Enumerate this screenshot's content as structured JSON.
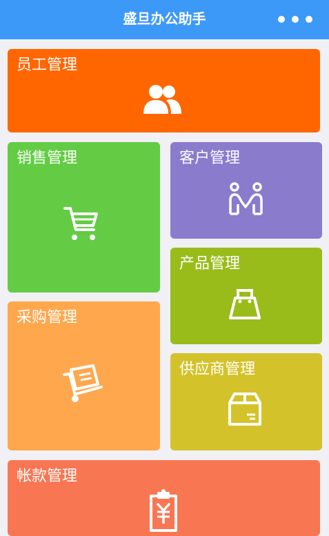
{
  "header": {
    "title": "盛旦办公助手",
    "more_icon": "more-dots-icon",
    "background": "#3d99f8"
  },
  "tiles": [
    {
      "id": "employee",
      "label": "员工管理",
      "icon": "users-icon",
      "color": "#ff6600"
    },
    {
      "id": "sales",
      "label": "销售管理",
      "icon": "shopping-cart-icon",
      "color": "#63cc44"
    },
    {
      "id": "customer",
      "label": "客户管理",
      "icon": "handshake-people-icon",
      "color": "#8a7bcd"
    },
    {
      "id": "product",
      "label": "产品管理",
      "icon": "shopping-bag-icon",
      "color": "#99bc1a"
    },
    {
      "id": "purchase",
      "label": "采购管理",
      "icon": "hand-truck-icon",
      "color": "#ffa74d"
    },
    {
      "id": "supplier",
      "label": "供应商管理",
      "icon": "package-box-icon",
      "color": "#d4c22b"
    },
    {
      "id": "account",
      "label": "帐款管理",
      "icon": "yuan-clipboard-icon",
      "color": "#f97653"
    }
  ]
}
